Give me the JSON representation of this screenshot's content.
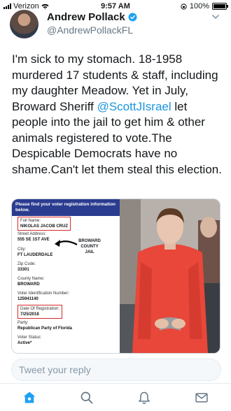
{
  "status_bar": {
    "carrier": "Verizon",
    "time": "9:57 AM",
    "battery": "100%"
  },
  "tweet": {
    "author_name": "Andrew Pollack",
    "author_handle": "@AndrewPollackFL",
    "text_before": "I'm sick to my stomach. 18-1958 murdered 17 students & staff, including my daughter Meadow. Yet in July, Broward Sheriff ",
    "mention": "@ScottJIsrael",
    "text_after": " let people into the jail to get him & other animals registered to vote.The Despicable Democrats have no shame.Can't let them steal this election."
  },
  "media": {
    "form_header": "Please find your voter registration information below.",
    "fields": [
      {
        "label": "Full Name:",
        "value": "NIKOLAS JACOB CRUZ"
      },
      {
        "label": "Street Address:",
        "value": "555 SE 1ST AVE"
      },
      {
        "label": "City:",
        "value": "FT LAUDERDALE"
      },
      {
        "label": "Zip Code:",
        "value": "33301"
      },
      {
        "label": "County Name:",
        "value": "BROWARD"
      },
      {
        "label": "Voter Identification Number:",
        "value": "125941140"
      },
      {
        "label": "Date Of Registration:",
        "value": "7/25/2018"
      },
      {
        "label": "Party:",
        "value": "Republican Party of Florida"
      },
      {
        "label": "Voter Status:",
        "value": "Active*"
      }
    ],
    "annotation": "BROWARD COUNTY JAIL"
  },
  "reply": {
    "placeholder": "Tweet your reply"
  },
  "tabs": [
    "home-icon",
    "search-icon",
    "notifications-icon",
    "messages-icon"
  ],
  "colors": {
    "accent": "#1da1f2",
    "mention": "#1b95e0",
    "form_header": "#2a3c8f",
    "highlight": "#d42b2b"
  }
}
